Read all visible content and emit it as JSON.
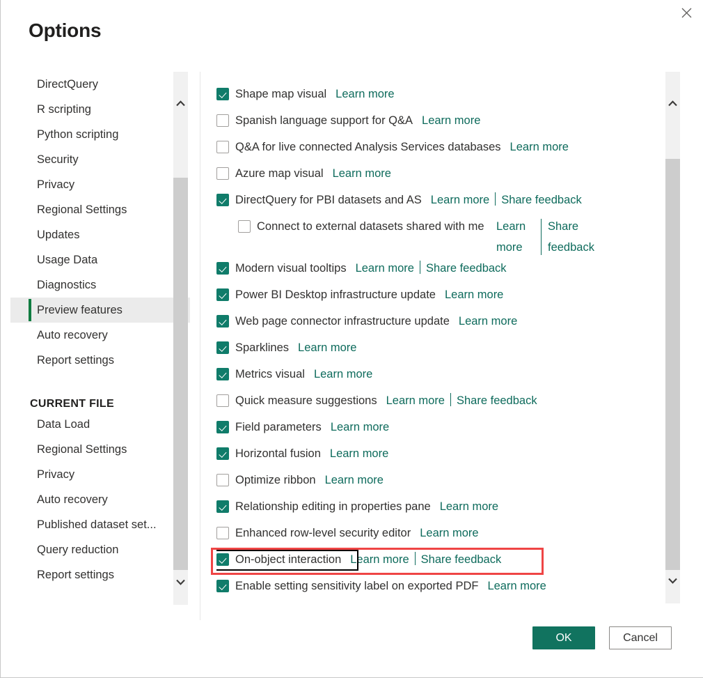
{
  "dialog": {
    "title": "Options",
    "close_label": "Close"
  },
  "sidebar": {
    "global_items": [
      {
        "label": "DirectQuery",
        "selected": false
      },
      {
        "label": "R scripting",
        "selected": false
      },
      {
        "label": "Python scripting",
        "selected": false
      },
      {
        "label": "Security",
        "selected": false
      },
      {
        "label": "Privacy",
        "selected": false
      },
      {
        "label": "Regional Settings",
        "selected": false
      },
      {
        "label": "Updates",
        "selected": false
      },
      {
        "label": "Usage Data",
        "selected": false
      },
      {
        "label": "Diagnostics",
        "selected": false
      },
      {
        "label": "Preview features",
        "selected": true
      },
      {
        "label": "Auto recovery",
        "selected": false
      },
      {
        "label": "Report settings",
        "selected": false
      }
    ],
    "group_heading": "CURRENT FILE",
    "current_file_items": [
      {
        "label": "Data Load",
        "selected": false
      },
      {
        "label": "Regional Settings",
        "selected": false
      },
      {
        "label": "Privacy",
        "selected": false
      },
      {
        "label": "Auto recovery",
        "selected": false
      },
      {
        "label": "Published dataset set...",
        "selected": false
      },
      {
        "label": "Query reduction",
        "selected": false
      },
      {
        "label": "Report settings",
        "selected": false
      }
    ]
  },
  "links": {
    "learn_more": "Learn more",
    "share_feedback": "Share feedback",
    "learn": "Learn",
    "more": "more",
    "share": "Share",
    "feedback": "feedback"
  },
  "preview_features": [
    {
      "label": "Shape map visual",
      "checked": true,
      "learn_more": true,
      "share_feedback": false
    },
    {
      "label": "Spanish language support for Q&A",
      "checked": false,
      "learn_more": true,
      "share_feedback": false
    },
    {
      "label": "Q&A for live connected Analysis Services databases",
      "checked": false,
      "learn_more": true,
      "share_feedback": false
    },
    {
      "label": "Azure map visual",
      "checked": false,
      "learn_more": true,
      "share_feedback": false
    },
    {
      "label": "DirectQuery for PBI datasets and AS",
      "checked": true,
      "learn_more": true,
      "share_feedback": true
    },
    {
      "label": "Connect to external datasets shared with me",
      "checked": false,
      "learn_more": true,
      "share_feedback": true,
      "indent": true,
      "wrapped": true
    },
    {
      "label": "Modern visual tooltips",
      "checked": true,
      "learn_more": true,
      "share_feedback": true
    },
    {
      "label": "Power BI Desktop infrastructure update",
      "checked": true,
      "learn_more": true,
      "share_feedback": false
    },
    {
      "label": "Web page connector infrastructure update",
      "checked": true,
      "learn_more": true,
      "share_feedback": false
    },
    {
      "label": "Sparklines",
      "checked": true,
      "learn_more": true,
      "share_feedback": false
    },
    {
      "label": "Metrics visual",
      "checked": true,
      "learn_more": true,
      "share_feedback": false
    },
    {
      "label": "Quick measure suggestions",
      "checked": false,
      "learn_more": true,
      "share_feedback": true
    },
    {
      "label": "Field parameters",
      "checked": true,
      "learn_more": true,
      "share_feedback": false
    },
    {
      "label": "Horizontal fusion",
      "checked": true,
      "learn_more": true,
      "share_feedback": false
    },
    {
      "label": "Optimize ribbon",
      "checked": false,
      "learn_more": true,
      "share_feedback": false
    },
    {
      "label": "Relationship editing in properties pane",
      "checked": true,
      "learn_more": true,
      "share_feedback": false
    },
    {
      "label": "Enhanced row-level security editor",
      "checked": false,
      "learn_more": true,
      "share_feedback": false
    },
    {
      "label": "On-object interaction",
      "checked": true,
      "learn_more": true,
      "share_feedback": true,
      "focused": true,
      "highlighted": true
    },
    {
      "label": "Enable setting sensitivity label on exported PDF",
      "checked": true,
      "learn_more": true,
      "share_feedback": false
    }
  ],
  "footer": {
    "ok_label": "OK",
    "cancel_label": "Cancel"
  },
  "colors": {
    "accent_green": "#107c6a",
    "link_green": "#0e6b5c",
    "primary_button": "#11735f",
    "selection_bar": "#107c41",
    "highlight_red": "#ef4545",
    "focus_black": "#000000"
  }
}
